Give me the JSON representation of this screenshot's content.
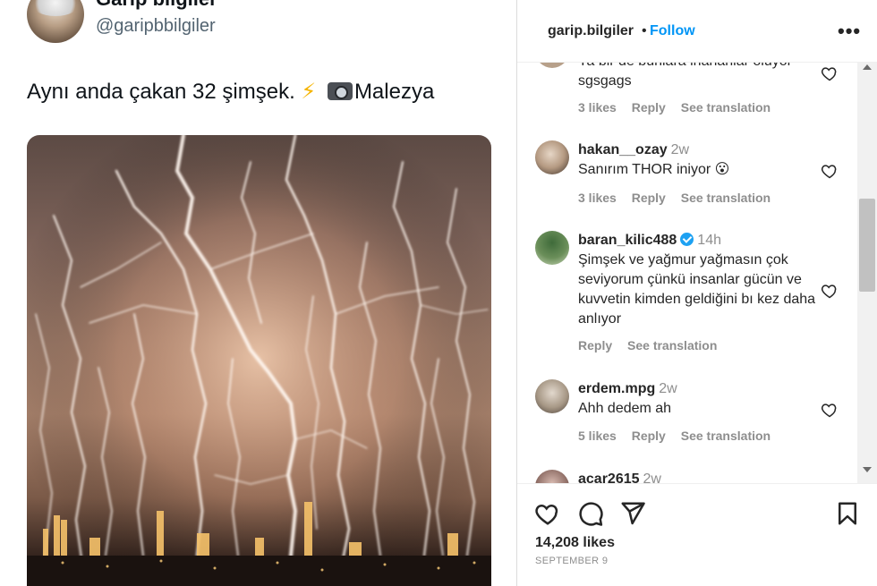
{
  "tweet": {
    "name": "Garip bilgiler",
    "handle": "@garipbbilgiler",
    "text_main": "Aynı anda çakan 32 şimşek.",
    "bolt_emoji": "⚡",
    "camera_icon": "camera-flash-emoji",
    "text_place": "Malezya"
  },
  "instagram": {
    "username": "garip.bilgiler",
    "separator": "•",
    "follow_label": "Follow",
    "more_label": "•••",
    "comments": [
      {
        "user": "",
        "time": "",
        "text": "Ya bir de bunlara inananlar oluyor sgsgags",
        "likes": "3 likes",
        "reply": "Reply",
        "translate": "See translation"
      },
      {
        "user": "hakan__ozay",
        "time": "2w",
        "text": "Sanırım THOR iniyor 😮",
        "likes": "3 likes",
        "reply": "Reply",
        "translate": "See translation"
      },
      {
        "user": "baran_kilic488",
        "time": "14h",
        "verified": true,
        "text": "Şimşek ve yağmur yağmasın çok seviyorum çünkü insanlar gücün ve kuvvetin kimden geldiğini bı kez daha anlıyor",
        "likes": "",
        "reply": "Reply",
        "translate": "See translation"
      },
      {
        "user": "erdem.mpg",
        "time": "2w",
        "text": "Ahh dedem ah",
        "likes": "5 likes",
        "reply": "Reply",
        "translate": "See translation"
      },
      {
        "user": "acar2615",
        "time": "2w",
        "text": "",
        "likes": "",
        "reply": "",
        "translate": ""
      }
    ],
    "like_count": "14,208 likes",
    "post_date": "SEPTEMBER 9",
    "icons": {
      "like": "heart-outline-icon",
      "comment": "comment-bubble-icon",
      "share": "paper-plane-icon",
      "save": "bookmark-icon"
    }
  }
}
